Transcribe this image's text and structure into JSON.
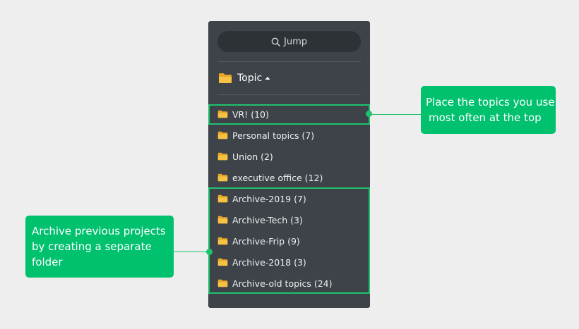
{
  "search": {
    "label": "Jump"
  },
  "header": {
    "label": "Topic"
  },
  "folders": [
    {
      "label": "VR! (10)"
    },
    {
      "label": "Personal topics (7)"
    },
    {
      "label": "Union (2)"
    },
    {
      "label": "executive office (12)"
    },
    {
      "label": "Archive-2019 (7)"
    },
    {
      "label": "Archive-Tech (3)"
    },
    {
      "label": "Archive-Frip (9)"
    },
    {
      "label": "Archive-2018 (3)"
    },
    {
      "label": "Archive-old topics (24)"
    }
  ],
  "callouts": {
    "top": {
      "line1": "Place the topics you use",
      "line2": "most often at the top"
    },
    "archive": {
      "line1": "Archive previous projects",
      "line2": "by creating a separate",
      "line3": "folder"
    }
  },
  "colors": {
    "accent": "#00c16e",
    "panel": "#3d4349",
    "folder": "#f6c244"
  }
}
